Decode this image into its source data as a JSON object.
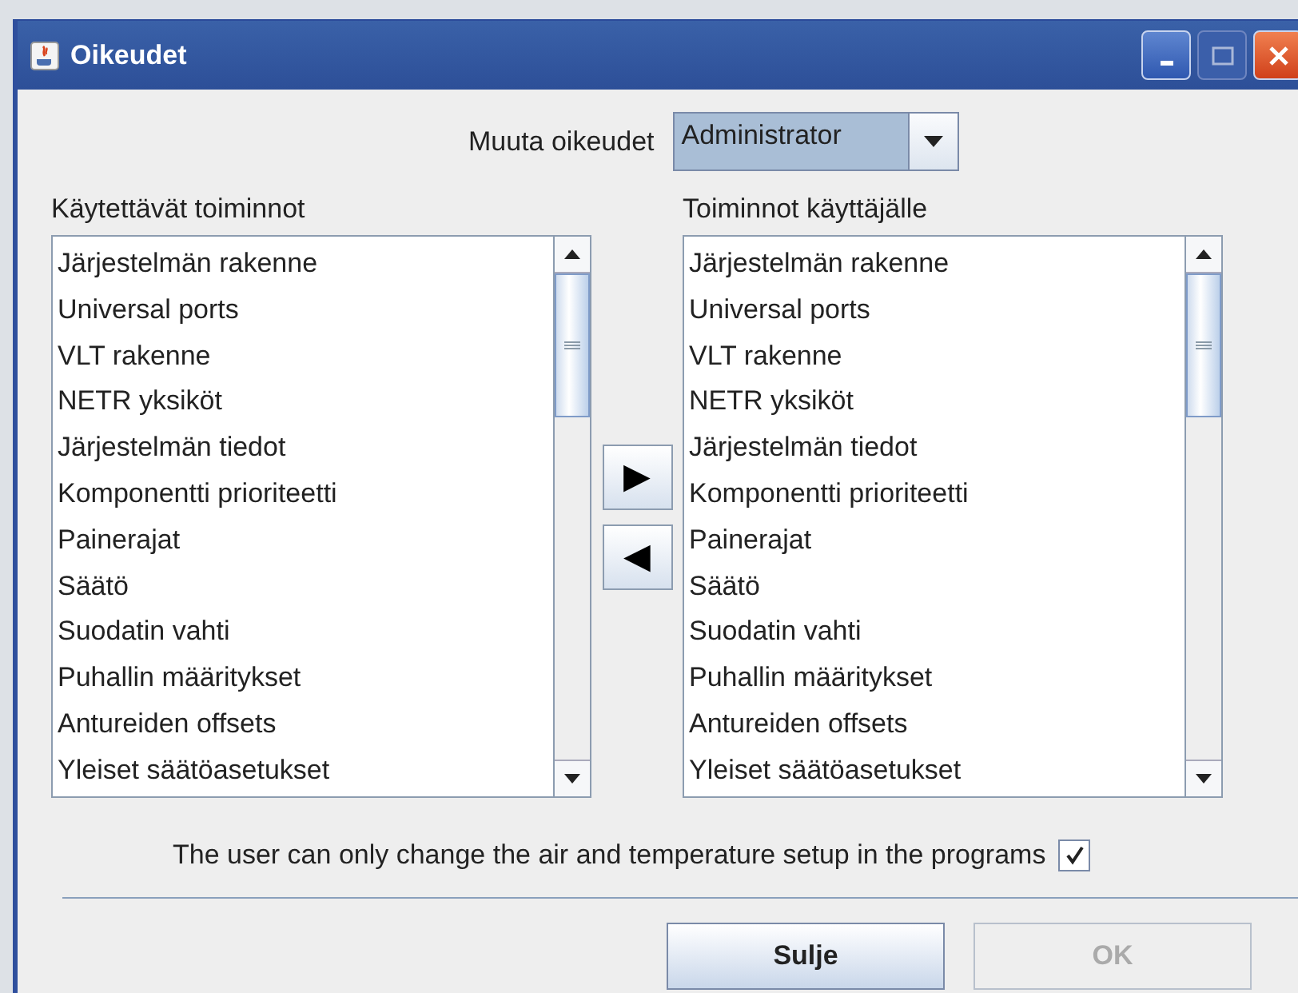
{
  "window": {
    "title": "Oikeudet"
  },
  "permission": {
    "label": "Muuta oikeudet",
    "value": "Administrator"
  },
  "lists": [
    {
      "title": "Käytettävät toiminnot",
      "items": [
        "Järjestelmän rakenne",
        "Universal ports",
        "VLT rakenne",
        "NETR yksiköt",
        "Järjestelmän tiedot",
        "Komponentti prioriteetti",
        "Painerajat",
        "Säätö",
        "Suodatin vahti",
        "Puhallin määritykset",
        "Antureiden offsets",
        "Yleiset säätöasetukset"
      ]
    },
    {
      "title": "Toiminnot käyttäjälle",
      "items": [
        "Järjestelmän rakenne",
        "Universal ports",
        "VLT rakenne",
        "NETR yksiköt",
        "Järjestelmän tiedot",
        "Komponentti prioriteetti",
        "Painerajat",
        "Säätö",
        "Suodatin vahti",
        "Puhallin määritykset",
        "Antureiden offsets",
        "Yleiset säätöasetukset"
      ]
    }
  ],
  "move_buttons": [
    "▶",
    "◀"
  ],
  "option": {
    "label": "The user can only change the air and temperature setup in the programs",
    "checked": true
  },
  "buttons": [
    {
      "label": "Sulje",
      "disabled": false
    },
    {
      "label": "OK",
      "disabled": true
    }
  ]
}
